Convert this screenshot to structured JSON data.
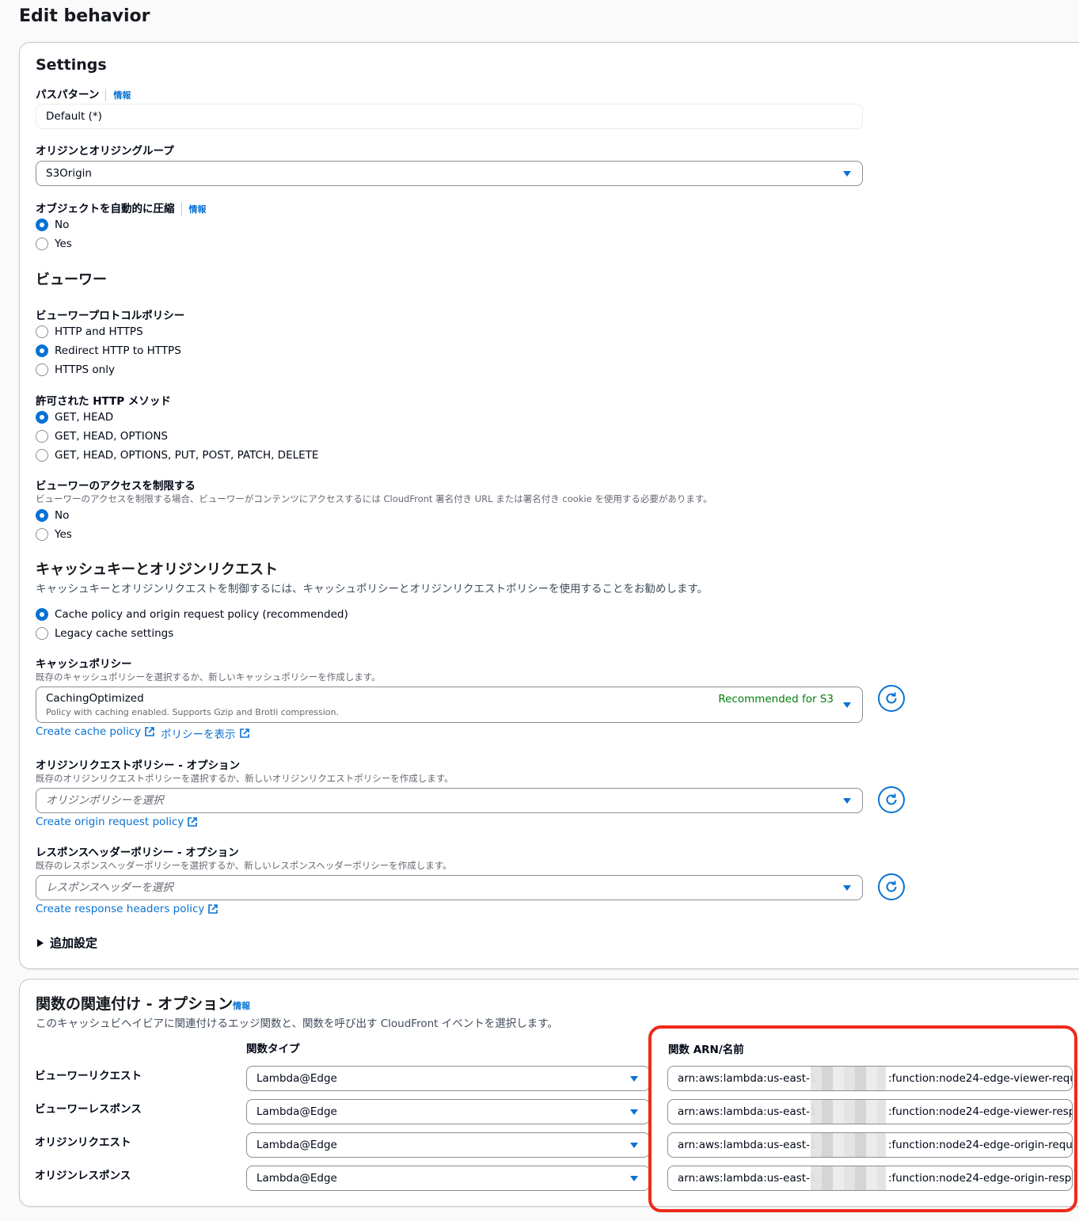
{
  "page": {
    "title": "Edit behavior"
  },
  "settings": {
    "heading": "Settings",
    "path_pattern": {
      "label": "パスパターン",
      "info": "情報",
      "value": "Default (*)"
    },
    "origin": {
      "label": "オリジンとオリジングループ",
      "value": "S3Origin"
    },
    "compress": {
      "label": "オブジェクトを自動的に圧縮",
      "info": "情報",
      "options": [
        "No",
        "Yes"
      ],
      "selected": "No"
    }
  },
  "viewer": {
    "heading": "ビューワー",
    "protocol_policy": {
      "label": "ビューワープロトコルポリシー",
      "options": [
        "HTTP and HTTPS",
        "Redirect HTTP to HTTPS",
        "HTTPS only"
      ],
      "selected": "Redirect HTTP to HTTPS"
    },
    "allowed_methods": {
      "label": "許可された HTTP メソッド",
      "options": [
        "GET, HEAD",
        "GET, HEAD, OPTIONS",
        "GET, HEAD, OPTIONS, PUT, POST, PATCH, DELETE"
      ],
      "selected": "GET, HEAD"
    },
    "restrict_access": {
      "label": "ビューワーのアクセスを制限する",
      "description": "ビューワーのアクセスを制限する場合、ビューワーがコンテンツにアクセスするには CloudFront 署名付き URL または署名付き cookie を使用する必要があります。",
      "options": [
        "No",
        "Yes"
      ],
      "selected": "No"
    }
  },
  "cache": {
    "heading": "キャッシュキーとオリジンリクエスト",
    "description": "キャッシュキーとオリジンリクエストを制御するには、キャッシュポリシーとオリジンリクエストポリシーを使用することをお勧めします。",
    "mode_options": [
      "Cache policy and origin request policy (recommended)",
      "Legacy cache settings"
    ],
    "mode_selected": "Cache policy and origin request policy (recommended)",
    "cache_policy": {
      "label": "キャッシュポリシー",
      "description": "既存のキャッシュポリシーを選択するか、新しいキャッシュポリシーを作成します。",
      "value": "CachingOptimized",
      "value_description": "Policy with caching enabled. Supports Gzip and Brotli compression.",
      "badge": "Recommended for S3",
      "create_link": "Create cache policy",
      "view_link": "ポリシーを表示"
    },
    "origin_request_policy": {
      "label": "オリジンリクエストポリシー - オプション",
      "description": "既存のオリジンリクエストポリシーを選択するか、新しいオリジンリクエストポリシーを作成します。",
      "placeholder": "オリジンポリシーを選択",
      "create_link": "Create origin request policy"
    },
    "response_headers_policy": {
      "label": "レスポンスヘッダーポリシー - オプション",
      "description": "既存のレスポンスヘッダーポリシーを選択するか、新しいレスポンスヘッダーポリシーを作成します。",
      "placeholder": "レスポンスヘッダーを選択",
      "create_link": "Create response headers policy"
    },
    "additional_settings": "追加設定"
  },
  "functions": {
    "heading": "関数の関連付け - オプション",
    "info": "情報",
    "description": "このキャッシュビヘイビアに関連付けるエッジ関数と、関数を呼び出す CloudFront イベントを選択します。",
    "col_type": "関数タイプ",
    "col_arn": "関数 ARN/名前",
    "rows": [
      {
        "event": "ビューワーリクエスト",
        "type": "Lambda@Edge",
        "arn_prefix": "arn:aws:lambda:us-east-1:",
        "arn_suffix": ":function:node24-edge-viewer-requ"
      },
      {
        "event": "ビューワーレスポンス",
        "type": "Lambda@Edge",
        "arn_prefix": "arn:aws:lambda:us-east-1:",
        "arn_suffix": ":function:node24-edge-viewer-resp"
      },
      {
        "event": "オリジンリクエスト",
        "type": "Lambda@Edge",
        "arn_prefix": "arn:aws:lambda:us-east-1:",
        "arn_suffix": ":function:node24-edge-origin-requ"
      },
      {
        "event": "オリジンレスポンス",
        "type": "Lambda@Edge",
        "arn_prefix": "arn:aws:lambda:us-east-1:",
        "arn_suffix": ":function:node24-edge-origin-resp"
      }
    ]
  },
  "colors": {
    "accent": "#0972d3",
    "badge": "#037f0c",
    "highlight": "#ee2a1b"
  },
  "icons": {
    "refresh": "refresh-icon",
    "external": "external-link-icon",
    "caret": "caret-down-icon",
    "expand": "caret-right-icon"
  }
}
